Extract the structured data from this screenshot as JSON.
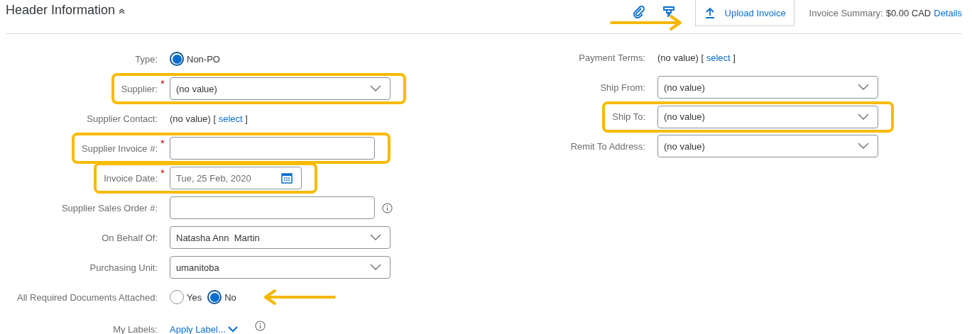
{
  "required_mark": "*",
  "header": {
    "title": "Header Information",
    "expanded": true,
    "upload_button": {
      "label": "Upload Invoice",
      "arrow_pointer": true
    },
    "summary": {
      "label": "Invoice Summary:",
      "amount": "$0.00 CAD",
      "link": "Details"
    }
  },
  "left_fields": [
    {
      "label": "Type:",
      "kind": "radio",
      "required": false,
      "highlighted": false,
      "info": false,
      "arrow_pointer": false,
      "options": [
        {
          "label": "Non-PO",
          "selected": true
        }
      ]
    },
    {
      "label": "Supplier:",
      "kind": "dropdown",
      "required": true,
      "highlighted": true,
      "info": false,
      "arrow_pointer": false,
      "value": "(no value)"
    },
    {
      "label": "Supplier Contact:",
      "kind": "value_select",
      "required": false,
      "highlighted": false,
      "info": false,
      "arrow_pointer": false,
      "value": "(no value) [",
      "link": "select",
      "suffix": "]"
    },
    {
      "label": "Supplier Invoice #:",
      "kind": "text",
      "required": true,
      "highlighted": true,
      "info": false,
      "arrow_pointer": false
    },
    {
      "label": "Invoice Date:",
      "kind": "date",
      "required": true,
      "highlighted": true,
      "info": false,
      "arrow_pointer": false,
      "value": "Tue, 25 Feb, 2020"
    },
    {
      "label": "Supplier Sales Order #:",
      "kind": "text",
      "required": false,
      "highlighted": false,
      "info": true,
      "arrow_pointer": false
    },
    {
      "label": "On Behalf Of:",
      "kind": "dropdown",
      "required": false,
      "highlighted": false,
      "info": false,
      "arrow_pointer": false,
      "value": "Natasha Ann  Martin"
    },
    {
      "label": "Purchasing Unit:",
      "kind": "dropdown",
      "required": false,
      "highlighted": false,
      "info": false,
      "arrow_pointer": false,
      "value": "umanitoba"
    },
    {
      "label": "All Required Documents Attached:",
      "kind": "radio",
      "required": false,
      "highlighted": false,
      "info": false,
      "arrow_pointer": true,
      "options": [
        {
          "label": "Yes",
          "selected": false
        },
        {
          "label": "No",
          "selected": true
        }
      ]
    },
    {
      "label": "My Labels:",
      "kind": "link_dropdown",
      "required": false,
      "highlighted": false,
      "info": true,
      "arrow_pointer": false,
      "link": "Apply Label..."
    }
  ],
  "right_fields": [
    {
      "label": "Payment Terms:",
      "kind": "value_select",
      "required": false,
      "highlighted": false,
      "info": false,
      "arrow_pointer": false,
      "value": "(no value) [",
      "link": "select",
      "suffix": "]"
    },
    {
      "label": "Ship From:",
      "kind": "dropdown",
      "required": false,
      "highlighted": false,
      "info": false,
      "arrow_pointer": false,
      "value": "(no value)"
    },
    {
      "label": "Ship To:",
      "kind": "dropdown",
      "required": false,
      "highlighted": true,
      "info": false,
      "arrow_pointer": false,
      "value": "(no value)"
    },
    {
      "label": "Remit To Address:",
      "kind": "dropdown",
      "required": false,
      "highlighted": false,
      "info": false,
      "arrow_pointer": false,
      "value": "(no value)"
    }
  ]
}
